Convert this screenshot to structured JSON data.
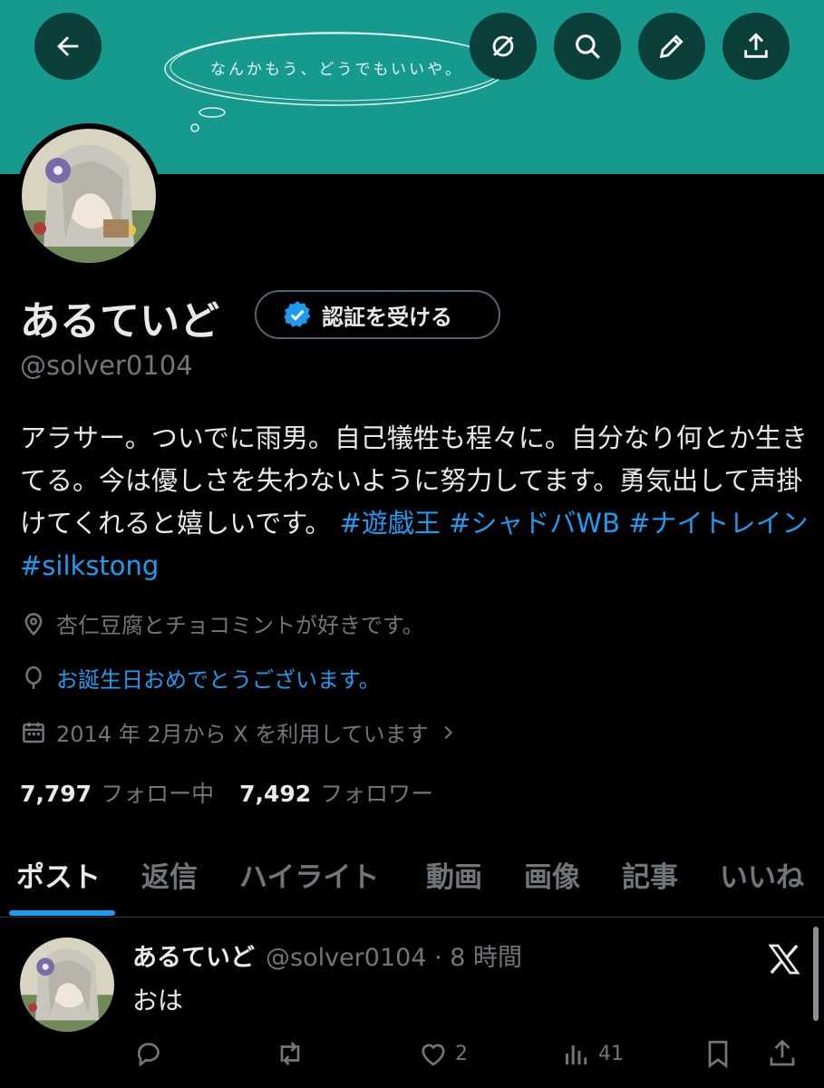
{
  "banner": {
    "text": "なんかもう、どうでもいいや。",
    "color": "#169a8e"
  },
  "header": {
    "back_icon": "arrow-left-icon",
    "grok_icon": "grok-icon",
    "search_icon": "search-icon",
    "edit_icon": "pencil-icon",
    "share_icon": "share-icon"
  },
  "profile": {
    "display_name": "あるていど",
    "verify_label": "認証を受ける",
    "handle": "@solver0104",
    "bio_text": "アラサー。ついでに雨男。自己犠牲も程々に。自分なり何とか生きてる。今は優しさを失わないように努力してます。勇気出して声掛けてくれると嬉しいです。",
    "bio_tags": [
      "#遊戯王",
      "#シャドバWB",
      "#ナイトレイン",
      "#silkstong"
    ],
    "location": "杏仁豆腐とチョコミントが好きです。",
    "birthday": "お誕生日おめでとうございます。",
    "joined": "2014 年 2月から X を利用しています",
    "following_count": "7,797",
    "following_label": "フォロー中",
    "followers_count": "7,492",
    "followers_label": "フォロワー"
  },
  "tabs": [
    "ポスト",
    "返信",
    "ハイライト",
    "動画",
    "画像",
    "記事",
    "いいね"
  ],
  "active_tab": "ポスト",
  "post": {
    "name": "あるていど",
    "handle_time": "@solver0104 · 8 時間",
    "text": "おは",
    "likes": "2",
    "views": "41"
  },
  "colors": {
    "accent": "#1d9bf0",
    "muted": "#71767b",
    "text": "#e7e9ea",
    "background": "#000000"
  }
}
